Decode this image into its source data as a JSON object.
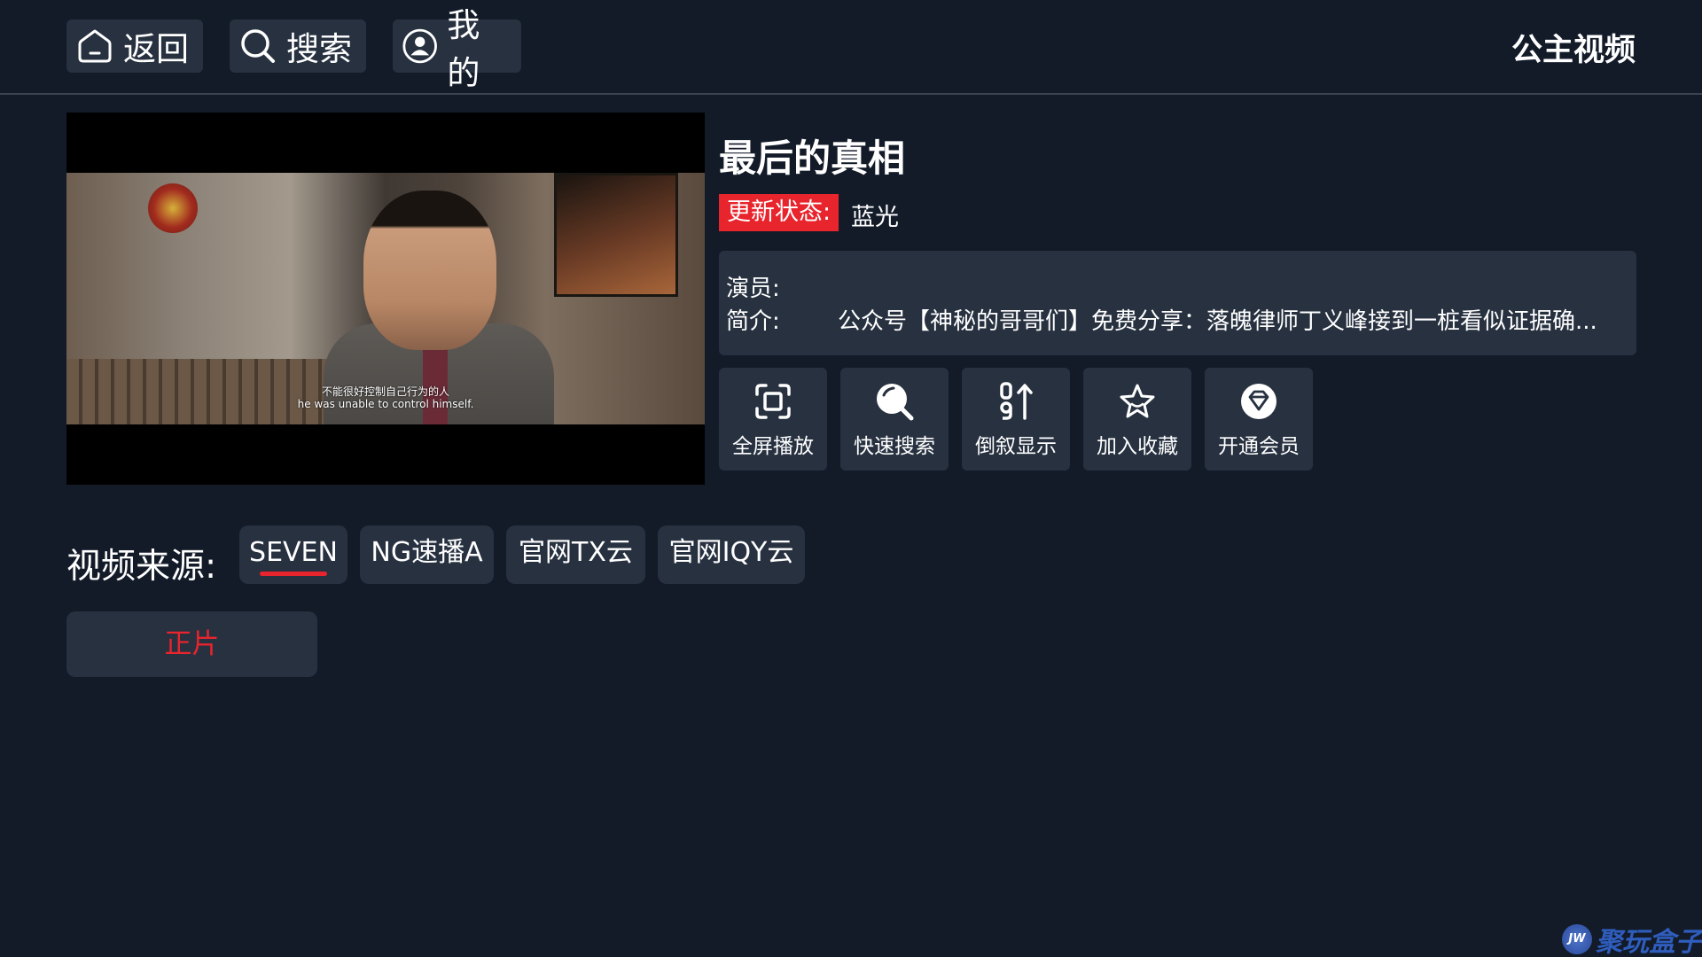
{
  "header": {
    "nav": [
      {
        "label": "返回",
        "icon": "home-icon"
      },
      {
        "label": "搜索",
        "icon": "search-icon"
      },
      {
        "label": "我的",
        "icon": "user-icon"
      }
    ],
    "brand": "公主视频"
  },
  "player": {
    "subtitle_cn": "不能很好控制自己行为的人",
    "subtitle_en": "he was unable to control himself."
  },
  "info": {
    "title": "最后的真相",
    "status_label": "更新状态:",
    "status_value": "蓝光",
    "actors_label": "演员:",
    "actors_value": "",
    "intro_label": "简介:",
    "intro_value": "公众号【神秘的哥哥们】免费分享：落魄律师丁义峰接到一桩看似证据确..."
  },
  "actions": [
    {
      "label": "全屏播放",
      "icon": "fullscreen-icon"
    },
    {
      "label": "快速搜索",
      "icon": "quick-search-icon"
    },
    {
      "label": "倒叙显示",
      "icon": "sort-order-icon"
    },
    {
      "label": "加入收藏",
      "icon": "star-icon"
    },
    {
      "label": "开通会员",
      "icon": "diamond-icon"
    }
  ],
  "sources": {
    "label": "视频来源:",
    "items": [
      "SEVEN",
      "NG速播A",
      "官网TX云",
      "官网IQY云"
    ],
    "selected": "SEVEN"
  },
  "episodes": [
    "正片"
  ],
  "watermark": {
    "logo": "JW",
    "text": "聚玩盒子"
  },
  "colors": {
    "background": "#131b29",
    "panel": "#273140",
    "accent": "#e8242d"
  }
}
